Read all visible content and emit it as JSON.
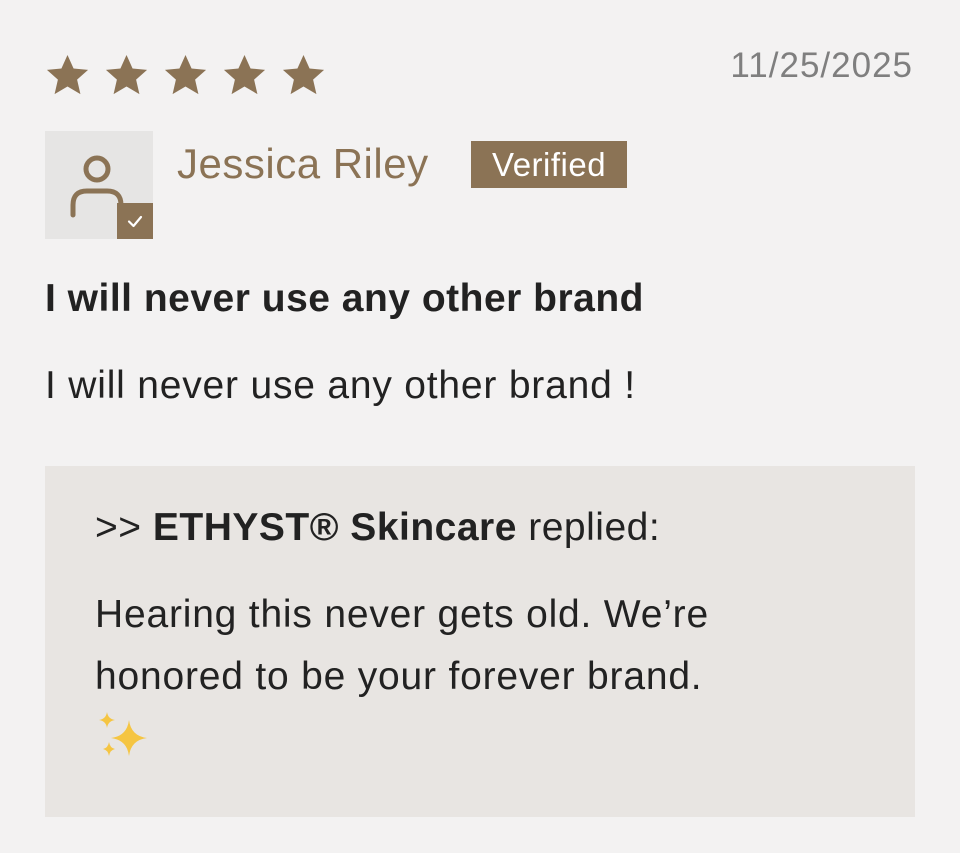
{
  "review": {
    "rating": 5,
    "rating_max": 5,
    "date": "11/25/2025",
    "author": "Jessica Riley",
    "verified_label": "Verified",
    "title": "I will never use any other brand",
    "body": "I will never use any other brand !"
  },
  "reply": {
    "prefix": ">> ",
    "brand": "ETHYST® Skincare",
    "suffix": " replied:",
    "body": "Hearing this never gets old. We’re honored to be your forever brand.",
    "emoji_icon": "sparkles-icon"
  },
  "colors": {
    "accent": "#8b7355",
    "background": "#f3f2f2",
    "reply_background": "#e8e5e2",
    "avatar_background": "#e6e5e4",
    "date_text": "#7f7f7f",
    "text": "#222222",
    "sparkle": "#f5c542"
  },
  "icons": {
    "star": "star-icon",
    "avatar": "user-icon",
    "verified_check": "checkmark-icon"
  }
}
